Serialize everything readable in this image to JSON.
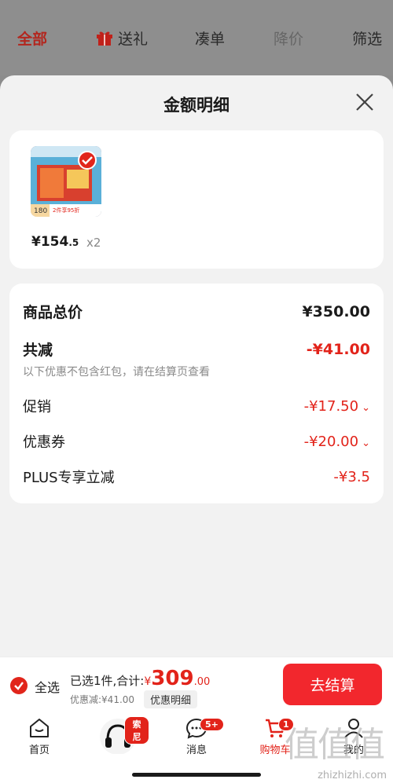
{
  "top_tabs": [
    {
      "label": "全部"
    },
    {
      "label": "送礼"
    },
    {
      "label": "凑单"
    },
    {
      "label": "降价"
    },
    {
      "label": "筛选"
    }
  ],
  "sheet": {
    "title": "金额明细",
    "item": {
      "thumb_price": "180",
      "thumb_promo": "2件享95折",
      "price_main": "¥154",
      "price_small": ".5",
      "qty": "x2"
    },
    "detail": {
      "total_label": "商品总价",
      "total_value": "¥350.00",
      "reduce_label": "共减",
      "reduce_value": "-¥41.00",
      "note": "以下优惠不包含红包，请在结算页查看",
      "lines": [
        {
          "label": "促销",
          "value": "-¥17.50"
        },
        {
          "label": "优惠券",
          "value": "-¥20.00"
        },
        {
          "label": "PLUS专享立减",
          "value": "-¥3.5"
        }
      ]
    }
  },
  "checkout": {
    "select_all": "全选",
    "summary_prefix": "已选1件,合计:",
    "currency": "¥",
    "total_int": "309",
    "total_dec": ".00",
    "discount": "优惠减:¥41.00",
    "detail_pill": "优惠明细",
    "button": "去结算"
  },
  "bottom_nav": {
    "home": "首页",
    "sony_badge": "索尼",
    "messages": "消息",
    "messages_badge": "5+",
    "cart": "购物车",
    "cart_badge": "1",
    "mine": "我的"
  },
  "watermark": "zhizhizhi.com",
  "watermark_glyphs": "值值值",
  "colors": {
    "accent": "#e2231a",
    "button": "#f2272d"
  }
}
